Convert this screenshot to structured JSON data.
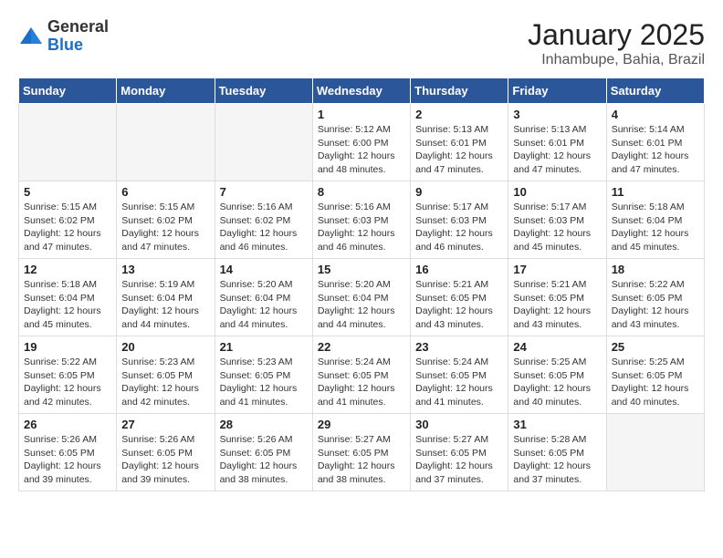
{
  "header": {
    "logo_general": "General",
    "logo_blue": "Blue",
    "month_title": "January 2025",
    "location": "Inhambupe, Bahia, Brazil"
  },
  "weekdays": [
    "Sunday",
    "Monday",
    "Tuesday",
    "Wednesday",
    "Thursday",
    "Friday",
    "Saturday"
  ],
  "weeks": [
    [
      {
        "day": "",
        "info": ""
      },
      {
        "day": "",
        "info": ""
      },
      {
        "day": "",
        "info": ""
      },
      {
        "day": "1",
        "info": "Sunrise: 5:12 AM\nSunset: 6:00 PM\nDaylight: 12 hours\nand 48 minutes."
      },
      {
        "day": "2",
        "info": "Sunrise: 5:13 AM\nSunset: 6:01 PM\nDaylight: 12 hours\nand 47 minutes."
      },
      {
        "day": "3",
        "info": "Sunrise: 5:13 AM\nSunset: 6:01 PM\nDaylight: 12 hours\nand 47 minutes."
      },
      {
        "day": "4",
        "info": "Sunrise: 5:14 AM\nSunset: 6:01 PM\nDaylight: 12 hours\nand 47 minutes."
      }
    ],
    [
      {
        "day": "5",
        "info": "Sunrise: 5:15 AM\nSunset: 6:02 PM\nDaylight: 12 hours\nand 47 minutes."
      },
      {
        "day": "6",
        "info": "Sunrise: 5:15 AM\nSunset: 6:02 PM\nDaylight: 12 hours\nand 47 minutes."
      },
      {
        "day": "7",
        "info": "Sunrise: 5:16 AM\nSunset: 6:02 PM\nDaylight: 12 hours\nand 46 minutes."
      },
      {
        "day": "8",
        "info": "Sunrise: 5:16 AM\nSunset: 6:03 PM\nDaylight: 12 hours\nand 46 minutes."
      },
      {
        "day": "9",
        "info": "Sunrise: 5:17 AM\nSunset: 6:03 PM\nDaylight: 12 hours\nand 46 minutes."
      },
      {
        "day": "10",
        "info": "Sunrise: 5:17 AM\nSunset: 6:03 PM\nDaylight: 12 hours\nand 45 minutes."
      },
      {
        "day": "11",
        "info": "Sunrise: 5:18 AM\nSunset: 6:04 PM\nDaylight: 12 hours\nand 45 minutes."
      }
    ],
    [
      {
        "day": "12",
        "info": "Sunrise: 5:18 AM\nSunset: 6:04 PM\nDaylight: 12 hours\nand 45 minutes."
      },
      {
        "day": "13",
        "info": "Sunrise: 5:19 AM\nSunset: 6:04 PM\nDaylight: 12 hours\nand 44 minutes."
      },
      {
        "day": "14",
        "info": "Sunrise: 5:20 AM\nSunset: 6:04 PM\nDaylight: 12 hours\nand 44 minutes."
      },
      {
        "day": "15",
        "info": "Sunrise: 5:20 AM\nSunset: 6:04 PM\nDaylight: 12 hours\nand 44 minutes."
      },
      {
        "day": "16",
        "info": "Sunrise: 5:21 AM\nSunset: 6:05 PM\nDaylight: 12 hours\nand 43 minutes."
      },
      {
        "day": "17",
        "info": "Sunrise: 5:21 AM\nSunset: 6:05 PM\nDaylight: 12 hours\nand 43 minutes."
      },
      {
        "day": "18",
        "info": "Sunrise: 5:22 AM\nSunset: 6:05 PM\nDaylight: 12 hours\nand 43 minutes."
      }
    ],
    [
      {
        "day": "19",
        "info": "Sunrise: 5:22 AM\nSunset: 6:05 PM\nDaylight: 12 hours\nand 42 minutes."
      },
      {
        "day": "20",
        "info": "Sunrise: 5:23 AM\nSunset: 6:05 PM\nDaylight: 12 hours\nand 42 minutes."
      },
      {
        "day": "21",
        "info": "Sunrise: 5:23 AM\nSunset: 6:05 PM\nDaylight: 12 hours\nand 41 minutes."
      },
      {
        "day": "22",
        "info": "Sunrise: 5:24 AM\nSunset: 6:05 PM\nDaylight: 12 hours\nand 41 minutes."
      },
      {
        "day": "23",
        "info": "Sunrise: 5:24 AM\nSunset: 6:05 PM\nDaylight: 12 hours\nand 41 minutes."
      },
      {
        "day": "24",
        "info": "Sunrise: 5:25 AM\nSunset: 6:05 PM\nDaylight: 12 hours\nand 40 minutes."
      },
      {
        "day": "25",
        "info": "Sunrise: 5:25 AM\nSunset: 6:05 PM\nDaylight: 12 hours\nand 40 minutes."
      }
    ],
    [
      {
        "day": "26",
        "info": "Sunrise: 5:26 AM\nSunset: 6:05 PM\nDaylight: 12 hours\nand 39 minutes."
      },
      {
        "day": "27",
        "info": "Sunrise: 5:26 AM\nSunset: 6:05 PM\nDaylight: 12 hours\nand 39 minutes."
      },
      {
        "day": "28",
        "info": "Sunrise: 5:26 AM\nSunset: 6:05 PM\nDaylight: 12 hours\nand 38 minutes."
      },
      {
        "day": "29",
        "info": "Sunrise: 5:27 AM\nSunset: 6:05 PM\nDaylight: 12 hours\nand 38 minutes."
      },
      {
        "day": "30",
        "info": "Sunrise: 5:27 AM\nSunset: 6:05 PM\nDaylight: 12 hours\nand 37 minutes."
      },
      {
        "day": "31",
        "info": "Sunrise: 5:28 AM\nSunset: 6:05 PM\nDaylight: 12 hours\nand 37 minutes."
      },
      {
        "day": "",
        "info": ""
      }
    ]
  ]
}
